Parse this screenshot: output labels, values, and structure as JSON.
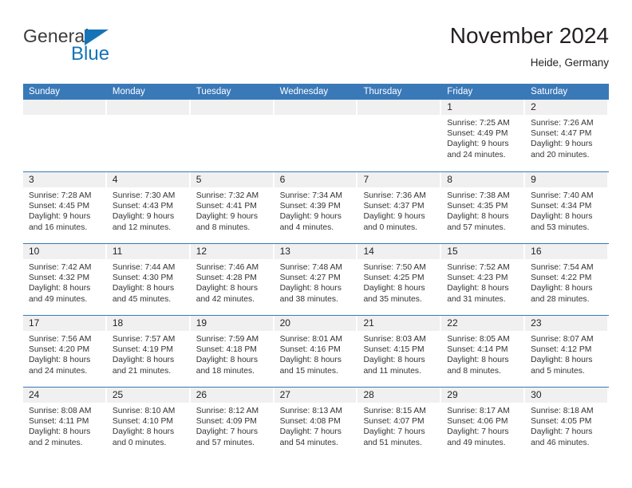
{
  "brand": {
    "name_primary": "General",
    "name_secondary": "Blue",
    "primary_color": "#3b3b3b",
    "accent_color": "#1574b8"
  },
  "header": {
    "title": "November 2024",
    "location": "Heide, Germany"
  },
  "calendar": {
    "header_color": "#3a79b8",
    "daynum_band_color": "#f0f0f0",
    "weekdays": [
      "Sunday",
      "Monday",
      "Tuesday",
      "Wednesday",
      "Thursday",
      "Friday",
      "Saturday"
    ],
    "weeks": [
      [
        {
          "day": ""
        },
        {
          "day": ""
        },
        {
          "day": ""
        },
        {
          "day": ""
        },
        {
          "day": ""
        },
        {
          "day": "1",
          "sunrise": "Sunrise: 7:25 AM",
          "sunset": "Sunset: 4:49 PM",
          "daylight_1": "Daylight: 9 hours",
          "daylight_2": "and 24 minutes."
        },
        {
          "day": "2",
          "sunrise": "Sunrise: 7:26 AM",
          "sunset": "Sunset: 4:47 PM",
          "daylight_1": "Daylight: 9 hours",
          "daylight_2": "and 20 minutes."
        }
      ],
      [
        {
          "day": "3",
          "sunrise": "Sunrise: 7:28 AM",
          "sunset": "Sunset: 4:45 PM",
          "daylight_1": "Daylight: 9 hours",
          "daylight_2": "and 16 minutes."
        },
        {
          "day": "4",
          "sunrise": "Sunrise: 7:30 AM",
          "sunset": "Sunset: 4:43 PM",
          "daylight_1": "Daylight: 9 hours",
          "daylight_2": "and 12 minutes."
        },
        {
          "day": "5",
          "sunrise": "Sunrise: 7:32 AM",
          "sunset": "Sunset: 4:41 PM",
          "daylight_1": "Daylight: 9 hours",
          "daylight_2": "and 8 minutes."
        },
        {
          "day": "6",
          "sunrise": "Sunrise: 7:34 AM",
          "sunset": "Sunset: 4:39 PM",
          "daylight_1": "Daylight: 9 hours",
          "daylight_2": "and 4 minutes."
        },
        {
          "day": "7",
          "sunrise": "Sunrise: 7:36 AM",
          "sunset": "Sunset: 4:37 PM",
          "daylight_1": "Daylight: 9 hours",
          "daylight_2": "and 0 minutes."
        },
        {
          "day": "8",
          "sunrise": "Sunrise: 7:38 AM",
          "sunset": "Sunset: 4:35 PM",
          "daylight_1": "Daylight: 8 hours",
          "daylight_2": "and 57 minutes."
        },
        {
          "day": "9",
          "sunrise": "Sunrise: 7:40 AM",
          "sunset": "Sunset: 4:34 PM",
          "daylight_1": "Daylight: 8 hours",
          "daylight_2": "and 53 minutes."
        }
      ],
      [
        {
          "day": "10",
          "sunrise": "Sunrise: 7:42 AM",
          "sunset": "Sunset: 4:32 PM",
          "daylight_1": "Daylight: 8 hours",
          "daylight_2": "and 49 minutes."
        },
        {
          "day": "11",
          "sunrise": "Sunrise: 7:44 AM",
          "sunset": "Sunset: 4:30 PM",
          "daylight_1": "Daylight: 8 hours",
          "daylight_2": "and 45 minutes."
        },
        {
          "day": "12",
          "sunrise": "Sunrise: 7:46 AM",
          "sunset": "Sunset: 4:28 PM",
          "daylight_1": "Daylight: 8 hours",
          "daylight_2": "and 42 minutes."
        },
        {
          "day": "13",
          "sunrise": "Sunrise: 7:48 AM",
          "sunset": "Sunset: 4:27 PM",
          "daylight_1": "Daylight: 8 hours",
          "daylight_2": "and 38 minutes."
        },
        {
          "day": "14",
          "sunrise": "Sunrise: 7:50 AM",
          "sunset": "Sunset: 4:25 PM",
          "daylight_1": "Daylight: 8 hours",
          "daylight_2": "and 35 minutes."
        },
        {
          "day": "15",
          "sunrise": "Sunrise: 7:52 AM",
          "sunset": "Sunset: 4:23 PM",
          "daylight_1": "Daylight: 8 hours",
          "daylight_2": "and 31 minutes."
        },
        {
          "day": "16",
          "sunrise": "Sunrise: 7:54 AM",
          "sunset": "Sunset: 4:22 PM",
          "daylight_1": "Daylight: 8 hours",
          "daylight_2": "and 28 minutes."
        }
      ],
      [
        {
          "day": "17",
          "sunrise": "Sunrise: 7:56 AM",
          "sunset": "Sunset: 4:20 PM",
          "daylight_1": "Daylight: 8 hours",
          "daylight_2": "and 24 minutes."
        },
        {
          "day": "18",
          "sunrise": "Sunrise: 7:57 AM",
          "sunset": "Sunset: 4:19 PM",
          "daylight_1": "Daylight: 8 hours",
          "daylight_2": "and 21 minutes."
        },
        {
          "day": "19",
          "sunrise": "Sunrise: 7:59 AM",
          "sunset": "Sunset: 4:18 PM",
          "daylight_1": "Daylight: 8 hours",
          "daylight_2": "and 18 minutes."
        },
        {
          "day": "20",
          "sunrise": "Sunrise: 8:01 AM",
          "sunset": "Sunset: 4:16 PM",
          "daylight_1": "Daylight: 8 hours",
          "daylight_2": "and 15 minutes."
        },
        {
          "day": "21",
          "sunrise": "Sunrise: 8:03 AM",
          "sunset": "Sunset: 4:15 PM",
          "daylight_1": "Daylight: 8 hours",
          "daylight_2": "and 11 minutes."
        },
        {
          "day": "22",
          "sunrise": "Sunrise: 8:05 AM",
          "sunset": "Sunset: 4:14 PM",
          "daylight_1": "Daylight: 8 hours",
          "daylight_2": "and 8 minutes."
        },
        {
          "day": "23",
          "sunrise": "Sunrise: 8:07 AM",
          "sunset": "Sunset: 4:12 PM",
          "daylight_1": "Daylight: 8 hours",
          "daylight_2": "and 5 minutes."
        }
      ],
      [
        {
          "day": "24",
          "sunrise": "Sunrise: 8:08 AM",
          "sunset": "Sunset: 4:11 PM",
          "daylight_1": "Daylight: 8 hours",
          "daylight_2": "and 2 minutes."
        },
        {
          "day": "25",
          "sunrise": "Sunrise: 8:10 AM",
          "sunset": "Sunset: 4:10 PM",
          "daylight_1": "Daylight: 8 hours",
          "daylight_2": "and 0 minutes."
        },
        {
          "day": "26",
          "sunrise": "Sunrise: 8:12 AM",
          "sunset": "Sunset: 4:09 PM",
          "daylight_1": "Daylight: 7 hours",
          "daylight_2": "and 57 minutes."
        },
        {
          "day": "27",
          "sunrise": "Sunrise: 8:13 AM",
          "sunset": "Sunset: 4:08 PM",
          "daylight_1": "Daylight: 7 hours",
          "daylight_2": "and 54 minutes."
        },
        {
          "day": "28",
          "sunrise": "Sunrise: 8:15 AM",
          "sunset": "Sunset: 4:07 PM",
          "daylight_1": "Daylight: 7 hours",
          "daylight_2": "and 51 minutes."
        },
        {
          "day": "29",
          "sunrise": "Sunrise: 8:17 AM",
          "sunset": "Sunset: 4:06 PM",
          "daylight_1": "Daylight: 7 hours",
          "daylight_2": "and 49 minutes."
        },
        {
          "day": "30",
          "sunrise": "Sunrise: 8:18 AM",
          "sunset": "Sunset: 4:05 PM",
          "daylight_1": "Daylight: 7 hours",
          "daylight_2": "and 46 minutes."
        }
      ]
    ]
  }
}
